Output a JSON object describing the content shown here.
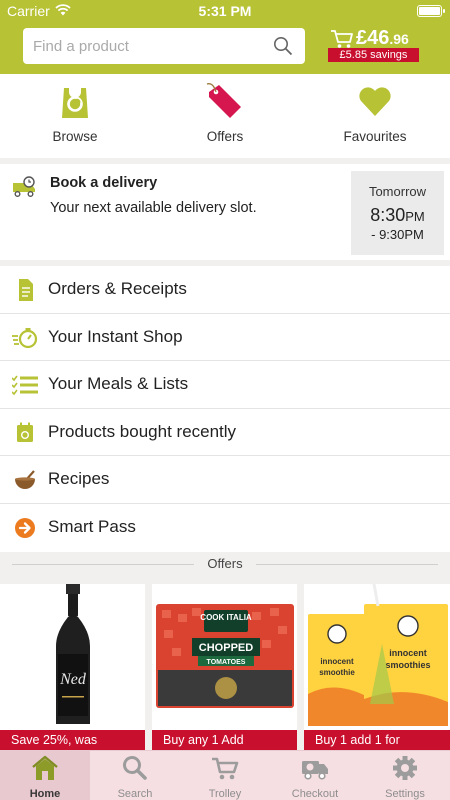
{
  "status": {
    "carrier": "Carrier",
    "time": "5:31 PM"
  },
  "header": {
    "search_placeholder": "Find a product",
    "trolley": {
      "pounds": "£46",
      "pence": ".96",
      "savings": "£5.85 savings"
    }
  },
  "quick_nav": [
    {
      "label": "Browse",
      "icon": "bag-icon"
    },
    {
      "label": "Offers",
      "icon": "price-tag-icon"
    },
    {
      "label": "Favourites",
      "icon": "heart-icon"
    }
  ],
  "delivery": {
    "title": "Book a delivery",
    "subtitle": "Your next available delivery slot.",
    "slot_day": "Tomorrow",
    "slot_start": "8:30",
    "slot_start_ampm": "PM",
    "slot_end": "- 9:30PM"
  },
  "menu": [
    {
      "label": "Orders & Receipts",
      "icon": "receipt-icon"
    },
    {
      "label": "Your Instant Shop",
      "icon": "stopwatch-icon"
    },
    {
      "label": "Your Meals & Lists",
      "icon": "list-icon"
    },
    {
      "label": "Products bought recently",
      "icon": "calendar-apple-icon"
    },
    {
      "label": "Recipes",
      "icon": "mixing-bowl-icon"
    },
    {
      "label": "Smart Pass",
      "icon": "arrow-circle-icon"
    }
  ],
  "offers": {
    "heading": "Offers",
    "cards": [
      {
        "band": "Save 25%, was",
        "product_text": "Ned"
      },
      {
        "band": "Buy any 1 Add",
        "product_brand": "COOK ITALIA",
        "product_name": "CHOPPED",
        "product_sub": "TOMATOES"
      },
      {
        "band": "Buy 1 add 1 for",
        "product_brand": "innocent",
        "product_name": "smoothie",
        "product_name2": "smoothies"
      }
    ]
  },
  "tabbar": [
    {
      "label": "Home",
      "icon": "home-icon",
      "active": true
    },
    {
      "label": "Search",
      "icon": "search-icon"
    },
    {
      "label": "Trolley",
      "icon": "trolley-icon"
    },
    {
      "label": "Checkout",
      "icon": "delivery-van-icon"
    },
    {
      "label": "Settings",
      "icon": "gear-icon"
    }
  ],
  "colors": {
    "brand_green": "#b7c235",
    "offer_red": "#c8102e",
    "tabbar_pink": "#f7dfe3"
  }
}
